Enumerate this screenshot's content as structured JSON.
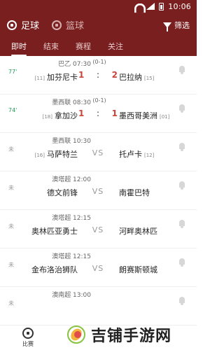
{
  "status": {
    "time": "10:06"
  },
  "sports": [
    {
      "label": "足球",
      "active": true,
      "icon": "soccer-ball-icon"
    },
    {
      "label": "篮球",
      "active": false,
      "icon": "basketball-icon"
    }
  ],
  "filter": {
    "label": "筛选",
    "icon": "filter-icon"
  },
  "tabs": [
    {
      "label": "即时",
      "active": true
    },
    {
      "label": "结束",
      "active": false
    },
    {
      "label": "赛程",
      "active": false
    },
    {
      "label": "关注",
      "active": false
    }
  ],
  "matches": [
    {
      "minute": "77'",
      "live": true,
      "league": "巴乙 07:30",
      "half": "(0-1)",
      "home_rank": "[11]",
      "home": "加芬尼卡",
      "home_score": "1",
      "sep": ":",
      "away_score": "2",
      "away": "巴拉纳",
      "away_rank": "[15]"
    },
    {
      "minute": "74'",
      "live": true,
      "league": "墨西联 08:30",
      "half": "(0-1)",
      "home_rank": "[18]",
      "home": "拿加沙",
      "home_score": "1",
      "sep": ":",
      "away_score": "1",
      "away": "墨西哥美洲",
      "away_rank": "[01]"
    },
    {
      "minute": "未",
      "live": false,
      "league": "墨西联 10:30",
      "half": "",
      "home_rank": "[16]",
      "home": "马萨特兰",
      "vs": "VS",
      "away": "托卢卡",
      "away_rank": "[12]"
    },
    {
      "minute": "未",
      "live": false,
      "league": "澳塔超 12:00",
      "half": "",
      "home_rank": "",
      "home": "德文前锋",
      "vs": "VS",
      "away": "南霍巴特",
      "away_rank": ""
    },
    {
      "minute": "未",
      "live": false,
      "league": "澳塔超 12:15",
      "half": "",
      "home_rank": "",
      "home": "奥林匹亚勇士",
      "vs": "VS",
      "away": "河畔奥林匹",
      "away_rank": ""
    },
    {
      "minute": "未",
      "live": false,
      "league": "澳塔超 12:15",
      "half": "",
      "home_rank": "",
      "home": "金布洛治狮队",
      "vs": "VS",
      "away": "朗赛斯顿城",
      "away_rank": ""
    },
    {
      "minute": "未",
      "live": false,
      "league": "澳南超 13:00",
      "half": "",
      "home_rank": "",
      "home": "",
      "vs": "",
      "away": "",
      "away_rank": ""
    }
  ],
  "bottomnav": {
    "label": "比赛",
    "icon": "soccer-ball-icon"
  },
  "watermark": {
    "text": "吉铺手游网"
  }
}
